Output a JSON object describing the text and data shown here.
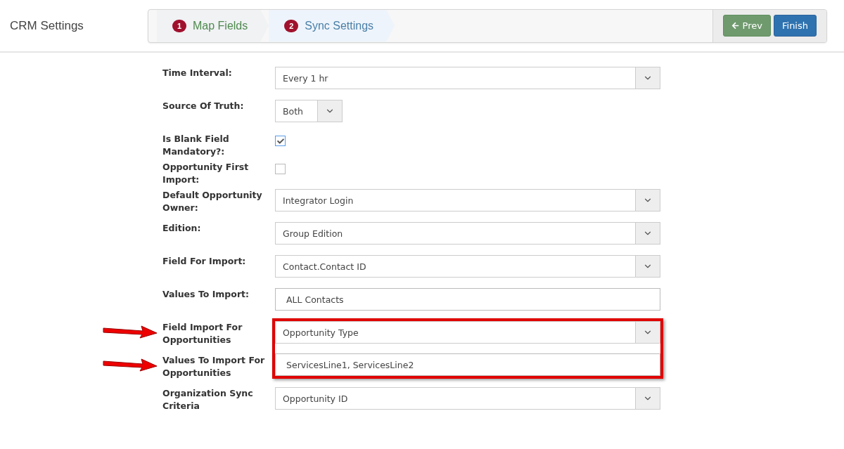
{
  "header": {
    "title": "CRM Settings",
    "steps": [
      {
        "number": "1",
        "label": "Map Fields",
        "selected": false
      },
      {
        "number": "2",
        "label": "Sync Settings",
        "selected": true
      }
    ],
    "buttons": [
      {
        "kind": "prev",
        "label": "Prev"
      },
      {
        "kind": "finish",
        "label": "Finish"
      }
    ]
  },
  "form": [
    {
      "kind": "select",
      "label": "Time Interval:",
      "value": "Every 1 hr",
      "highlighted": false,
      "arrow": false
    },
    {
      "kind": "select-small",
      "label": "Source Of Truth:",
      "value": "Both",
      "highlighted": false,
      "arrow": false
    },
    {
      "kind": "checkbox",
      "label": "Is Blank Field Mandatory?:",
      "checked": true,
      "highlighted": false,
      "arrow": false
    },
    {
      "kind": "checkbox",
      "label": "Opportunity First Import:",
      "checked": false,
      "highlighted": false,
      "arrow": false
    },
    {
      "kind": "select",
      "label": "Default Opportunity Owner:",
      "value": "Integrator Login",
      "highlighted": false,
      "arrow": false
    },
    {
      "kind": "select",
      "label": "Edition:",
      "value": "Group Edition",
      "highlighted": false,
      "arrow": false
    },
    {
      "kind": "select",
      "label": "Field For Import:",
      "value": "Contact.Contact ID",
      "highlighted": false,
      "arrow": false
    },
    {
      "kind": "text",
      "label": "Values To Import:",
      "value": "ALL Contacts",
      "highlighted": false,
      "arrow": false
    },
    {
      "kind": "select",
      "label": "Field Import For Opportunities",
      "value": "Opportunity Type",
      "highlighted": true,
      "arrow": true
    },
    {
      "kind": "text",
      "label": "Values To Import For Opportunities",
      "value": "ServicesLine1, ServicesLine2",
      "highlighted": true,
      "arrow": true
    },
    {
      "kind": "select",
      "label": "Organization Sync Criteria",
      "value": "Opportunity ID",
      "highlighted": false,
      "arrow": false
    }
  ]
}
